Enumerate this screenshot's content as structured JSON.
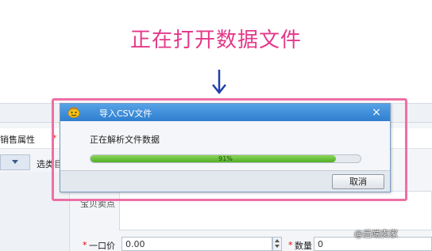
{
  "caption": "正在打开数据文件",
  "background_app": {
    "attribute_label": "销售属性",
    "select_label": "选类目",
    "desc_label": "宝贝卖点",
    "price_label": "一口价",
    "price_value": "0.00",
    "quantity_label": "数量",
    "quantity_value": "0",
    "required_mark": "*"
  },
  "dialog": {
    "title": "导入CSV文件",
    "close_symbol": "×",
    "status_text": "正在解析文件数据",
    "progress_percent": 91,
    "progress_label": "91%",
    "cancel_label": "取消"
  },
  "watermark": "@后端卖家"
}
